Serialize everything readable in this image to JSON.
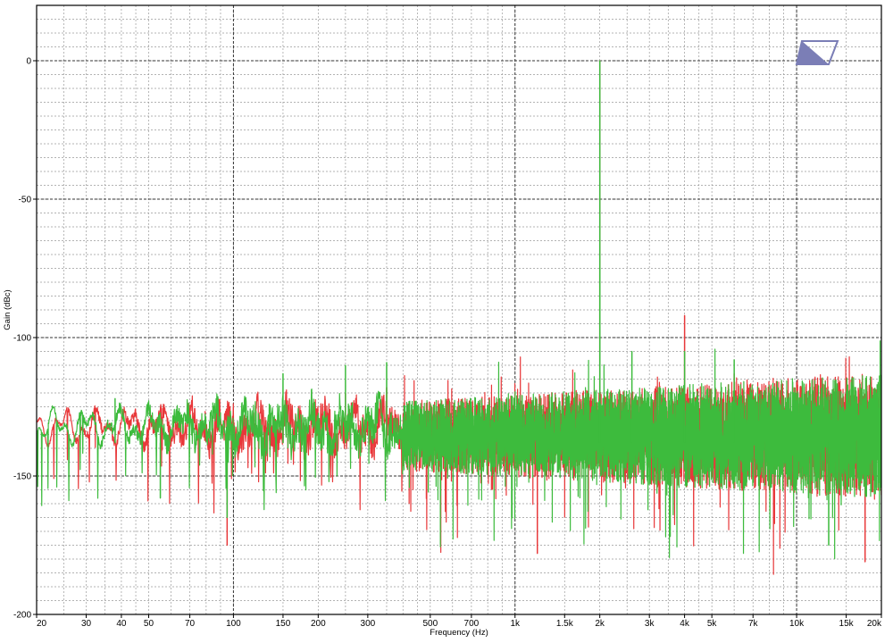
{
  "chart_data": {
    "type": "line",
    "xlabel": "Frequency (Hz)",
    "ylabel": "Gain (dBc)",
    "x_scale": "log",
    "xlim": [
      20,
      20000
    ],
    "ylim": [
      -200,
      20
    ],
    "x_ticks": [
      20,
      30,
      40,
      50,
      70,
      100,
      150,
      200,
      300,
      500,
      700,
      1000,
      1500,
      2000,
      3000,
      4000,
      5000,
      7000,
      10000,
      15000,
      20000
    ],
    "x_tick_labels": [
      "20",
      "30",
      "40",
      "50",
      "70",
      "100",
      "150",
      "200",
      "300",
      "500",
      "700",
      "1k",
      "1.5k",
      "2k",
      "3k",
      "4k",
      "5k",
      "7k",
      "10k",
      "15k",
      "20k"
    ],
    "y_ticks": [
      0,
      -50,
      -100,
      -150,
      -200
    ],
    "y_tick_labels": [
      "0",
      "-50",
      "-100",
      "-150",
      "-200"
    ],
    "grid": true,
    "legend": "none",
    "noise_floor_db": -138,
    "series": [
      {
        "color": "#e8383a",
        "peaks": [
          {
            "x": 2000,
            "y": 0
          },
          {
            "x": 4000,
            "y": -92
          },
          {
            "x": 6000,
            "y": -113
          },
          {
            "x": 3500,
            "y": -119
          },
          {
            "x": 150,
            "y": -125
          },
          {
            "x": 250,
            "y": -120
          },
          {
            "x": 350,
            "y": -118
          },
          {
            "x": 95,
            "y": -175
          },
          {
            "x": 1200,
            "y": -178
          },
          {
            "x": 17500,
            "y": -181
          }
        ]
      },
      {
        "color": "#3dbb3d",
        "peaks": [
          {
            "x": 2000,
            "y": 0
          },
          {
            "x": 2000,
            "y": -75
          },
          {
            "x": 2600,
            "y": -105
          },
          {
            "x": 4000,
            "y": -105
          },
          {
            "x": 6000,
            "y": -108
          },
          {
            "x": 350,
            "y": -109
          },
          {
            "x": 250,
            "y": -110
          },
          {
            "x": 150,
            "y": -113
          },
          {
            "x": 38,
            "y": -122
          },
          {
            "x": 55,
            "y": -158
          },
          {
            "x": 95,
            "y": -165
          },
          {
            "x": 13000,
            "y": -175
          }
        ]
      }
    ]
  },
  "logo": {
    "name": "audio-precision-logo",
    "color": "#7b7eb6"
  }
}
